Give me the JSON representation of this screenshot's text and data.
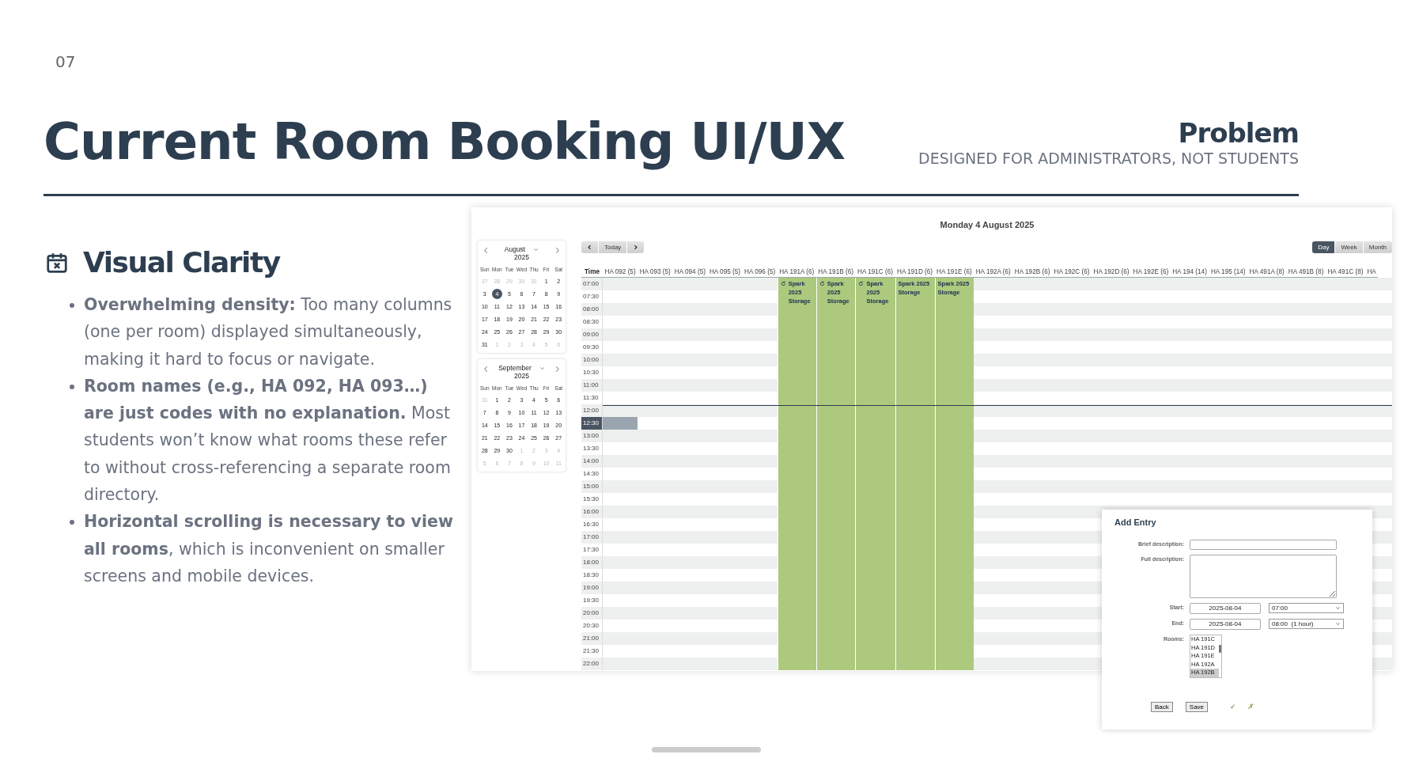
{
  "slide": {
    "number": "07",
    "title": "Current Room Booking UI/UX",
    "tag": "Problem",
    "subtitle": "DESIGNED FOR ADMINISTRATORS, NOT STUDENTS"
  },
  "section": {
    "heading": "Visual Clarity",
    "bullets": [
      "**Overwhelming density:** Too many columns (one per room) displayed simultaneously, making it hard to focus or navigate.",
      "**Room names (e.g., HA 092, HA 093…) are just codes with no explanation.** Most students won’t know what rooms these refer to without cross-referencing a separate room directory.",
      "**Horizontal scrolling is necessary to view all rooms**, which is inconvenient on smaller screens and mobile devices."
    ]
  },
  "app": {
    "date_title": "Monday 4 August 2025",
    "calendars": [
      {
        "month": "August",
        "year": "2025",
        "weekdays": [
          "Sun",
          "Mon",
          "Tue",
          "Wed",
          "Thu",
          "Fri",
          "Sat"
        ],
        "days": [
          {
            "text": "27",
            "outside": true,
            "selected": false
          },
          {
            "text": "28",
            "outside": true,
            "selected": false
          },
          {
            "text": "29",
            "outside": true,
            "selected": false
          },
          {
            "text": "30",
            "outside": true,
            "selected": false
          },
          {
            "text": "31",
            "outside": true,
            "selected": false
          },
          {
            "text": "1",
            "outside": false,
            "selected": false
          },
          {
            "text": "2",
            "outside": false,
            "selected": false
          },
          {
            "text": "3",
            "outside": false,
            "selected": false
          },
          {
            "text": "4",
            "outside": false,
            "selected": true
          },
          {
            "text": "5",
            "outside": false,
            "selected": false
          },
          {
            "text": "6",
            "outside": false,
            "selected": false
          },
          {
            "text": "7",
            "outside": false,
            "selected": false
          },
          {
            "text": "8",
            "outside": false,
            "selected": false
          },
          {
            "text": "9",
            "outside": false,
            "selected": false
          },
          {
            "text": "10",
            "outside": false,
            "selected": false
          },
          {
            "text": "11",
            "outside": false,
            "selected": false
          },
          {
            "text": "12",
            "outside": false,
            "selected": false
          },
          {
            "text": "13",
            "outside": false,
            "selected": false
          },
          {
            "text": "14",
            "outside": false,
            "selected": false
          },
          {
            "text": "15",
            "outside": false,
            "selected": false
          },
          {
            "text": "16",
            "outside": false,
            "selected": false
          },
          {
            "text": "17",
            "outside": false,
            "selected": false
          },
          {
            "text": "18",
            "outside": false,
            "selected": false
          },
          {
            "text": "19",
            "outside": false,
            "selected": false
          },
          {
            "text": "20",
            "outside": false,
            "selected": false
          },
          {
            "text": "21",
            "outside": false,
            "selected": false
          },
          {
            "text": "22",
            "outside": false,
            "selected": false
          },
          {
            "text": "23",
            "outside": false,
            "selected": false
          },
          {
            "text": "24",
            "outside": false,
            "selected": false
          },
          {
            "text": "25",
            "outside": false,
            "selected": false
          },
          {
            "text": "26",
            "outside": false,
            "selected": false
          },
          {
            "text": "27",
            "outside": false,
            "selected": false
          },
          {
            "text": "28",
            "outside": false,
            "selected": false
          },
          {
            "text": "29",
            "outside": false,
            "selected": false
          },
          {
            "text": "30",
            "outside": false,
            "selected": false
          },
          {
            "text": "31",
            "outside": false,
            "selected": false
          },
          {
            "text": "1",
            "outside": true,
            "selected": false
          },
          {
            "text": "2",
            "outside": true,
            "selected": false
          },
          {
            "text": "3",
            "outside": true,
            "selected": false
          },
          {
            "text": "4",
            "outside": true,
            "selected": false
          },
          {
            "text": "5",
            "outside": true,
            "selected": false
          },
          {
            "text": "6",
            "outside": true,
            "selected": false
          }
        ]
      },
      {
        "month": "September",
        "year": "2025",
        "weekdays": [
          "Sun",
          "Mon",
          "Tue",
          "Wed",
          "Thu",
          "Fri",
          "Sat"
        ],
        "days": [
          {
            "text": "31",
            "outside": true,
            "selected": false
          },
          {
            "text": "1",
            "outside": false,
            "selected": false
          },
          {
            "text": "2",
            "outside": false,
            "selected": false
          },
          {
            "text": "3",
            "outside": false,
            "selected": false
          },
          {
            "text": "4",
            "outside": false,
            "selected": false
          },
          {
            "text": "5",
            "outside": false,
            "selected": false
          },
          {
            "text": "6",
            "outside": false,
            "selected": false
          },
          {
            "text": "7",
            "outside": false,
            "selected": false
          },
          {
            "text": "8",
            "outside": false,
            "selected": false
          },
          {
            "text": "9",
            "outside": false,
            "selected": false
          },
          {
            "text": "10",
            "outside": false,
            "selected": false
          },
          {
            "text": "11",
            "outside": false,
            "selected": false
          },
          {
            "text": "12",
            "outside": false,
            "selected": false
          },
          {
            "text": "13",
            "outside": false,
            "selected": false
          },
          {
            "text": "14",
            "outside": false,
            "selected": false
          },
          {
            "text": "15",
            "outside": false,
            "selected": false
          },
          {
            "text": "16",
            "outside": false,
            "selected": false
          },
          {
            "text": "17",
            "outside": false,
            "selected": false
          },
          {
            "text": "18",
            "outside": false,
            "selected": false
          },
          {
            "text": "19",
            "outside": false,
            "selected": false
          },
          {
            "text": "20",
            "outside": false,
            "selected": false
          },
          {
            "text": "21",
            "outside": false,
            "selected": false
          },
          {
            "text": "22",
            "outside": false,
            "selected": false
          },
          {
            "text": "23",
            "outside": false,
            "selected": false
          },
          {
            "text": "24",
            "outside": false,
            "selected": false
          },
          {
            "text": "25",
            "outside": false,
            "selected": false
          },
          {
            "text": "26",
            "outside": false,
            "selected": false
          },
          {
            "text": "27",
            "outside": false,
            "selected": false
          },
          {
            "text": "28",
            "outside": false,
            "selected": false
          },
          {
            "text": "29",
            "outside": false,
            "selected": false
          },
          {
            "text": "30",
            "outside": false,
            "selected": false
          },
          {
            "text": "1",
            "outside": true,
            "selected": false
          },
          {
            "text": "2",
            "outside": true,
            "selected": false
          },
          {
            "text": "3",
            "outside": true,
            "selected": false
          },
          {
            "text": "4",
            "outside": true,
            "selected": false
          },
          {
            "text": "5",
            "outside": true,
            "selected": false
          },
          {
            "text": "6",
            "outside": true,
            "selected": false
          },
          {
            "text": "7",
            "outside": true,
            "selected": false
          },
          {
            "text": "8",
            "outside": true,
            "selected": false
          },
          {
            "text": "9",
            "outside": true,
            "selected": false
          },
          {
            "text": "10",
            "outside": true,
            "selected": false
          },
          {
            "text": "11",
            "outside": true,
            "selected": false
          }
        ]
      }
    ],
    "today_button": "Today",
    "views": [
      {
        "label": "Day",
        "selected": true
      },
      {
        "label": "Week",
        "selected": false
      },
      {
        "label": "Month",
        "selected": false
      }
    ],
    "grid": {
      "time_heading": "Time",
      "columns": [
        {
          "label": "HA 092 (5)"
        },
        {
          "label": "HA 093 (5)"
        },
        {
          "label": "HA 094 (5)"
        },
        {
          "label": "HA 095 (5)"
        },
        {
          "label": "HA 096 (5)"
        },
        {
          "label": "HA 191A (6)",
          "event": {
            "title": "Spark 2025 Storage",
            "recurring": true
          }
        },
        {
          "label": "HA 191B (6)",
          "event": {
            "title": "Spark 2025 Storage",
            "recurring": true
          }
        },
        {
          "label": "HA 191C (6)",
          "event": {
            "title": "Spark 2025 Storage",
            "recurring": true
          }
        },
        {
          "label": "HA 191D (6)",
          "event": {
            "title": "Spark 2025 Storage",
            "recurring": false
          }
        },
        {
          "label": "HA 191E (6)",
          "event": {
            "title": "Spark 2025 Storage",
            "recurring": false
          }
        },
        {
          "label": "HA 192A (6)"
        },
        {
          "label": "HA 192B (6)"
        },
        {
          "label": "HA 192C (6)"
        },
        {
          "label": "HA 192D (6)"
        },
        {
          "label": "HA 192E (6)"
        },
        {
          "label": "HA 194 (14)"
        },
        {
          "label": "HA 195 (14)"
        },
        {
          "label": "HA 491A (8)"
        },
        {
          "label": "HA 491B (8)"
        },
        {
          "label": "HA 491C (8)"
        },
        {
          "label": "HA"
        }
      ],
      "rows": [
        {
          "time": "07:00",
          "selected": false,
          "current_time": false
        },
        {
          "time": "07:30",
          "selected": false,
          "current_time": false
        },
        {
          "time": "08:00",
          "selected": false,
          "current_time": false
        },
        {
          "time": "08:30",
          "selected": false,
          "current_time": false
        },
        {
          "time": "09:00",
          "selected": false,
          "current_time": false
        },
        {
          "time": "09:30",
          "selected": false,
          "current_time": false
        },
        {
          "time": "10:00",
          "selected": false,
          "current_time": false
        },
        {
          "time": "10:30",
          "selected": false,
          "current_time": false
        },
        {
          "time": "11:00",
          "selected": false,
          "current_time": false
        },
        {
          "time": "11:30",
          "selected": false,
          "current_time": false
        },
        {
          "time": "12:00",
          "selected": false,
          "current_time": true
        },
        {
          "time": "12:30",
          "selected": true,
          "current_time": false
        },
        {
          "time": "13:00",
          "selected": false,
          "current_time": false
        },
        {
          "time": "13:30",
          "selected": false,
          "current_time": false
        },
        {
          "time": "14:00",
          "selected": false,
          "current_time": false
        },
        {
          "time": "14:30",
          "selected": false,
          "current_time": false
        },
        {
          "time": "15:00",
          "selected": false,
          "current_time": false
        },
        {
          "time": "15:30",
          "selected": false,
          "current_time": false
        },
        {
          "time": "16:00",
          "selected": false,
          "current_time": false
        },
        {
          "time": "16:30",
          "selected": false,
          "current_time": false
        },
        {
          "time": "17:00",
          "selected": false,
          "current_time": false
        },
        {
          "time": "17:30",
          "selected": false,
          "current_time": false
        },
        {
          "time": "18:00",
          "selected": false,
          "current_time": false
        },
        {
          "time": "18:30",
          "selected": false,
          "current_time": false
        },
        {
          "time": "19:00",
          "selected": false,
          "current_time": false
        },
        {
          "time": "19:30",
          "selected": false,
          "current_time": false
        },
        {
          "time": "20:00",
          "selected": false,
          "current_time": false
        },
        {
          "time": "20:30",
          "selected": false,
          "current_time": false
        },
        {
          "time": "21:00",
          "selected": false,
          "current_time": false
        },
        {
          "time": "21:30",
          "selected": false,
          "current_time": false
        },
        {
          "time": "22:00",
          "selected": false,
          "current_time": false
        }
      ]
    },
    "dialog": {
      "title": "Add Entry",
      "brief_label": "Brief description:",
      "full_label": "Full description:",
      "start_label": "Start:",
      "start_date": "2025-08-04",
      "start_time": "07:00",
      "end_label": "End:",
      "end_date": "2025-08-04",
      "end_time": "08:00  (1 hour)",
      "rooms_label": "Rooms:",
      "rooms": [
        {
          "label": "HA 191C",
          "selected": false
        },
        {
          "label": "HA 191D",
          "selected": false
        },
        {
          "label": "HA 191E",
          "selected": false
        },
        {
          "label": "HA 192A",
          "selected": false
        },
        {
          "label": "HA 192B",
          "selected": true
        }
      ],
      "back_button": "Back",
      "save_button": "Save",
      "confirm": "✓",
      "cancel": "✗"
    }
  }
}
